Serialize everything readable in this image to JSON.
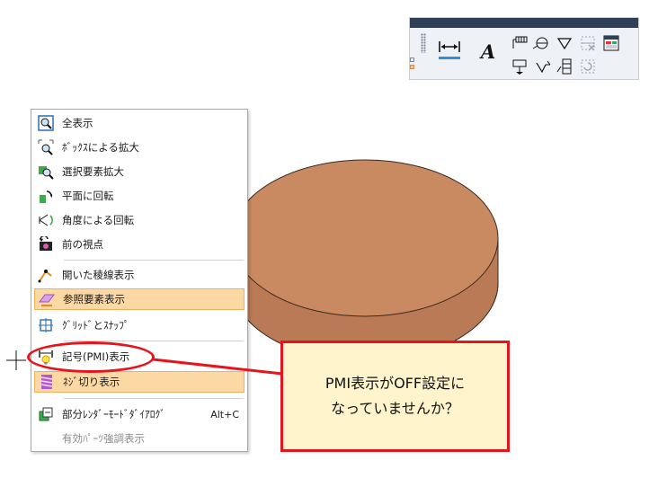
{
  "toolbar": {
    "italic_a": "A"
  },
  "menu": {
    "items": [
      {
        "label": "全表示",
        "icon": "fit-all-icon"
      },
      {
        "label": "ﾎﾞｯｸｽによる拡大",
        "icon": "box-zoom-icon"
      },
      {
        "label": "選択要素拡大",
        "icon": "zoom-selected-icon"
      },
      {
        "label": "平面に回転",
        "icon": "rotate-to-plane-icon"
      },
      {
        "label": "角度による回転",
        "icon": "rotate-by-angle-icon"
      },
      {
        "label": "前の視点",
        "icon": "previous-view-icon"
      },
      {
        "label": "開いた稜線表示",
        "icon": "open-edge-icon"
      },
      {
        "label": "参照要素表示",
        "icon": "reference-element-icon"
      },
      {
        "label": "ｸﾞﾘｯﾄﾞとｽﾅｯﾌﾟ",
        "icon": "grid-snap-icon"
      },
      {
        "label": "記号(PMI)表示",
        "icon": "pmi-symbol-icon"
      },
      {
        "label": "ﾈｼﾞ切り表示",
        "icon": "thread-display-icon"
      },
      {
        "label": "部分ﾚﾝﾀﾞｰﾓｰﾄﾞﾀﾞｲｱﾛｸﾞ",
        "icon": "partial-render-icon",
        "shortcut": "Alt+C"
      },
      {
        "label": "有効ﾊﾟｰﾂ強調表示",
        "icon": "none"
      }
    ]
  },
  "callout": {
    "line1": "PMI表示がOFF設定に",
    "line2": "なっていませんか？"
  },
  "colors": {
    "accent_red": "#e8141b",
    "callout_fill": "#fff4cc",
    "highlight": "#fcd9a4",
    "disc_top": "#c98a62",
    "disc_side": "#b97a55"
  }
}
